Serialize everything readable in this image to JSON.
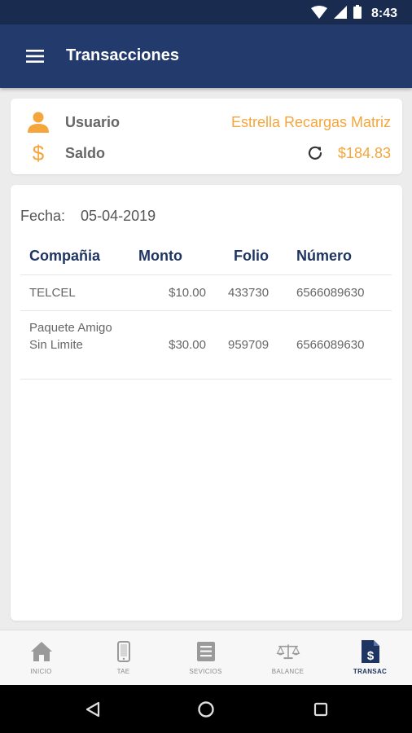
{
  "status_bar": {
    "time": "8:43"
  },
  "app_bar": {
    "title": "Transacciones",
    "menu_icon": "hamburger-menu-icon"
  },
  "account": {
    "user_label": "Usuario",
    "user_value": "Estrella Recargas Matriz",
    "balance_label": "Saldo",
    "balance_value": "$184.83"
  },
  "transactions": {
    "date_label": "Fecha:",
    "date_value": "05-04-2019",
    "columns": [
      "Compañia",
      "Monto",
      "Folio",
      "Número"
    ],
    "rows": [
      {
        "company": "TELCEL",
        "amount": "$10.00",
        "folio": "433730",
        "number": "6566089630"
      },
      {
        "company": "Paquete Amigo Sin Limite",
        "amount": "$30.00",
        "folio": "959709",
        "number": "6566089630"
      }
    ]
  },
  "bottom_nav": [
    {
      "label": "INICIO",
      "icon": "home-icon"
    },
    {
      "label": "TAE",
      "icon": "phone-icon"
    },
    {
      "label": "SEVICIOS",
      "icon": "list-icon"
    },
    {
      "label": "BALANCE",
      "icon": "scale-icon"
    },
    {
      "label": "TRANSAC",
      "icon": "invoice-dollar-icon",
      "active": true
    }
  ],
  "colors": {
    "header": "#233a6c",
    "status_bar": "#1a2b50",
    "accent": "#f4a63c",
    "table_header_text": "#1f3561"
  }
}
